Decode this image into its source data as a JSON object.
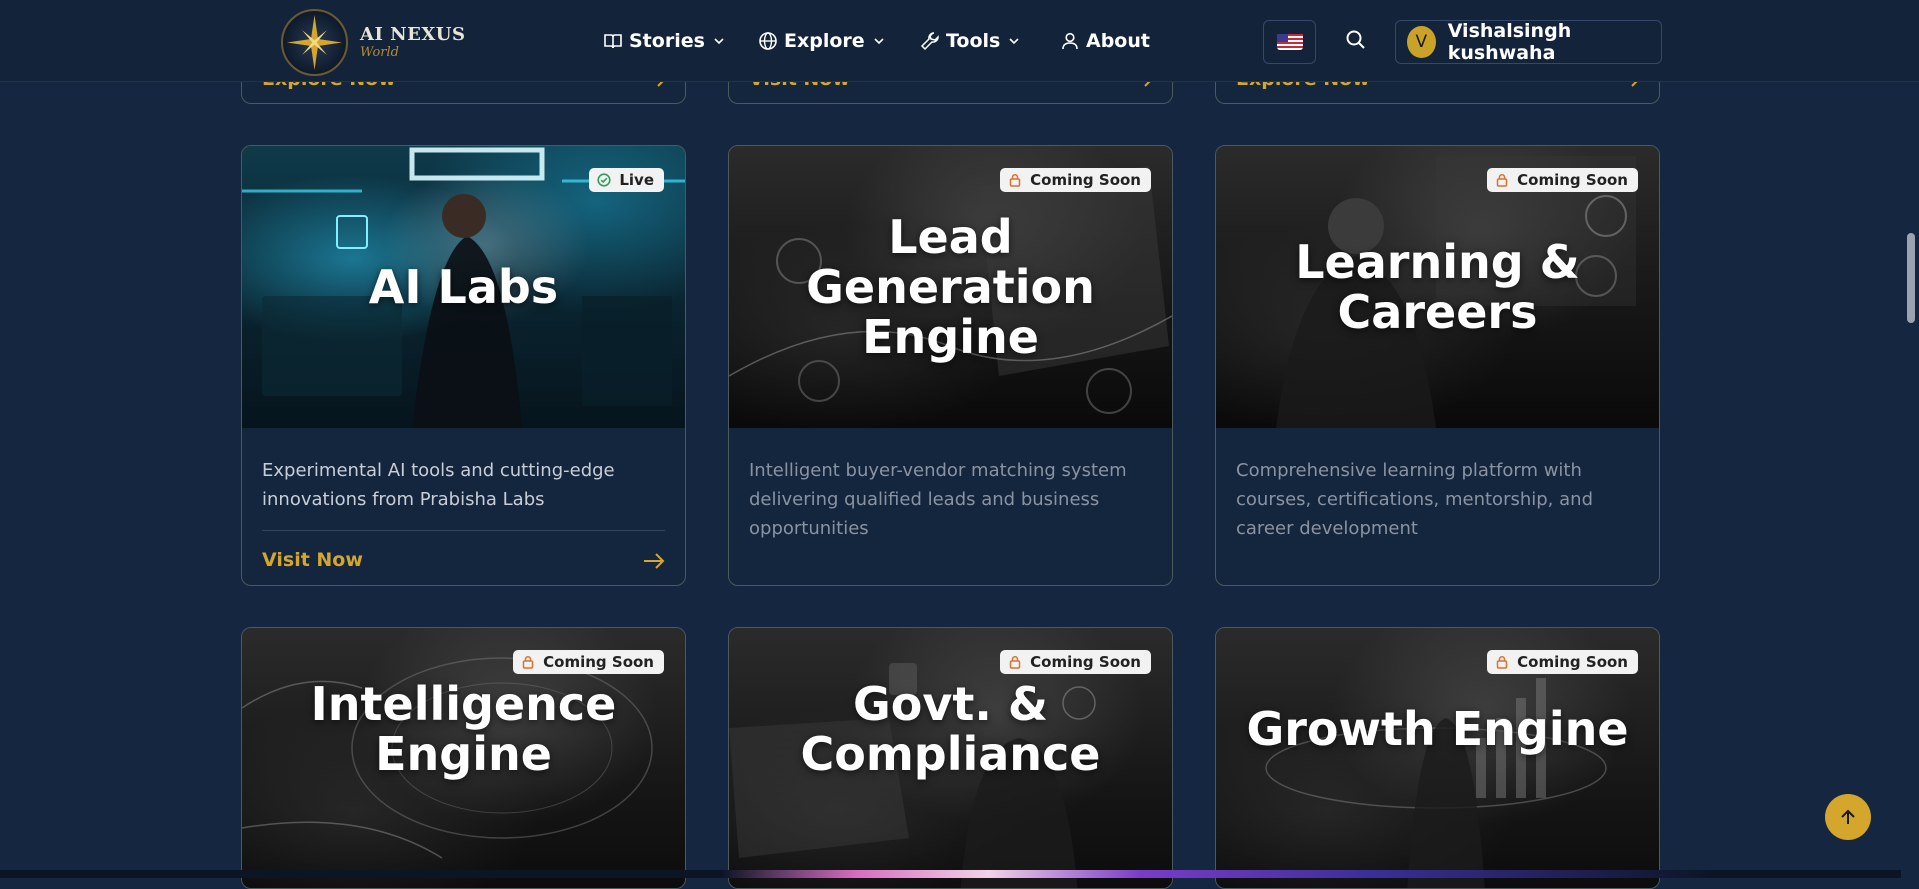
{
  "brand": {
    "title": "AI NEXUS",
    "subtitle": "World"
  },
  "nav": {
    "stories": "Stories",
    "explore": "Explore",
    "tools": "Tools",
    "about": "About"
  },
  "user": {
    "initial": "V",
    "name": "Vishalsingh kushwaha"
  },
  "top_row": [
    {
      "link": "Explore Now"
    },
    {
      "link": "Visit Now"
    },
    {
      "link": "Explore Now"
    }
  ],
  "cards": [
    {
      "title": "AI Labs",
      "badge": "Live",
      "status": "live",
      "description": "Experimental AI tools and cutting-edge innovations from Prabisha Labs",
      "link": "Visit Now"
    },
    {
      "title": "Lead Generation Engine",
      "badge": "Coming Soon",
      "status": "coming-soon",
      "description": "Intelligent buyer-vendor matching system delivering qualified leads and business opportunities"
    },
    {
      "title": "Learning & Careers",
      "badge": "Coming Soon",
      "status": "coming-soon",
      "description": "Comprehensive learning platform with courses, certifications, mentorship, and career development"
    },
    {
      "title": "Intelligence Engine",
      "badge": "Coming Soon",
      "status": "coming-soon"
    },
    {
      "title": "Govt. & Compliance",
      "badge": "Coming Soon",
      "status": "coming-soon"
    },
    {
      "title": "Growth Engine",
      "badge": "Coming Soon",
      "status": "coming-soon"
    }
  ],
  "colors": {
    "accent": "#d4a72c",
    "background": "#152640",
    "live_green": "#2e9e5b",
    "soon_orange": "#e0702a"
  }
}
